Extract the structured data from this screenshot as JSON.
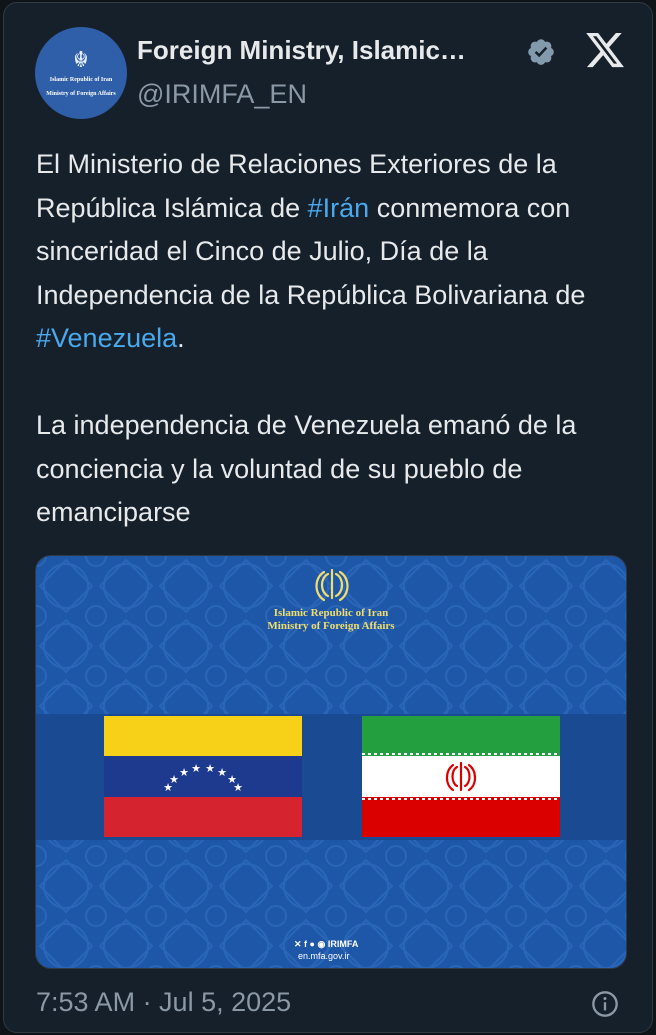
{
  "author": {
    "display_name": "Foreign Ministry, Islamic…",
    "handle": "@IRIMFA_EN",
    "avatar_line1": "Islamic Republic of Iran",
    "avatar_line2": "Ministry of Foreign Affairs"
  },
  "icons": {
    "verified": "verified-badge-icon",
    "platform": "x-logo-icon",
    "info": "info-icon"
  },
  "tweet": {
    "p1_a": "El Ministerio de Relaciones Exteriores de la República Islámica de ",
    "p1_tag1": "#Irán",
    "p1_b": " conmemora con sinceridad el Cinco de Julio, Día de la Independencia de la República Bolivariana de ",
    "p1_tag2": "#Venezuela",
    "p1_c": ".",
    "p2": "La independencia de Venezuela emanó de la conciencia y la voluntad de su pueblo de emanciparse"
  },
  "media": {
    "title1": "Islamic Republic of Iran",
    "title2": "Ministry of Foreign Affairs",
    "social": "IRIMFA",
    "url": "en.mfa.gov.ir"
  },
  "footer": {
    "timestamp": "7:53 AM · Jul 5, 2025"
  },
  "colors": {
    "background": "#16202b",
    "text": "#e7e9ea",
    "secondary": "#8b98a5",
    "hashtag": "#4aa8ec"
  }
}
